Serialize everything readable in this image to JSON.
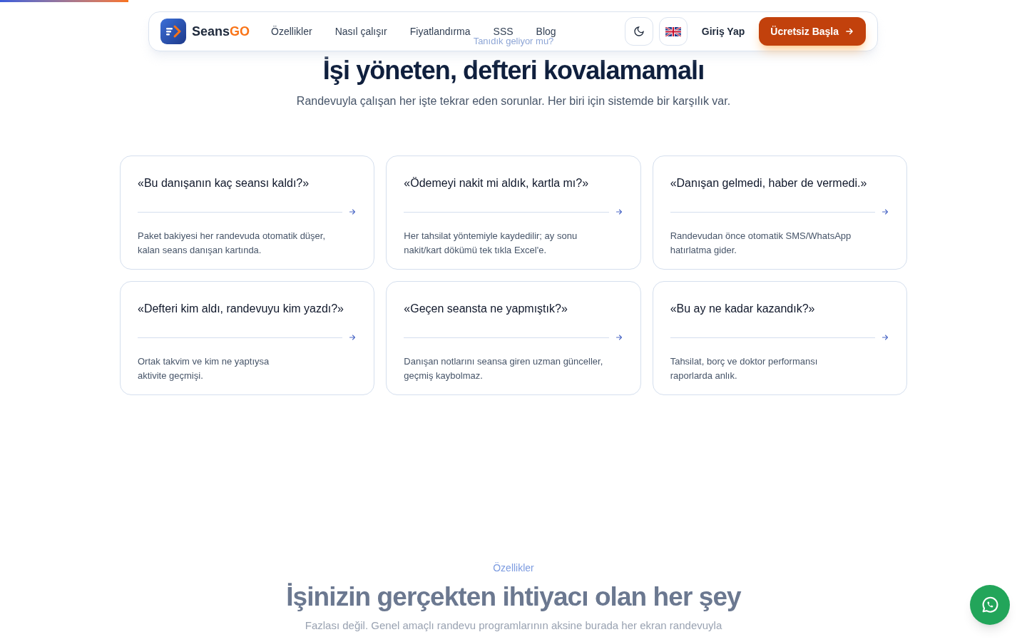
{
  "scroll_progress": {
    "level": 0.125
  },
  "nav": {
    "brand": {
      "first": "Seans",
      "second": "GO"
    },
    "links": [
      "Özellikler",
      "Nasıl çalışır",
      "Fiyatlandırma",
      "SSS",
      "Blog"
    ],
    "login": "Giriş Yap",
    "cta": "Ücretsiz Başla"
  },
  "problems": {
    "eyebrow": "Tanıdık geliyor mu?",
    "title": "İşi yöneten, defteri kovalamamalı",
    "subtitle": "Randevuyla çalışan her işte tekrar eden sorunlar. Her biri için sistemde bir karşılık var.",
    "cards": [
      {
        "question": "«Bu danışanın kaç seansı kaldı?»",
        "answer": "Paket bakiyesi her randevuda otomatik düşer,\nkalan seans danışan kartında."
      },
      {
        "question": "«Ödemeyi nakit mi aldık, kartla mı?»",
        "answer": "Her tahsilat yöntemiyle kaydedilir; ay sonu\nnakit/kart dökümü tek tıkla Excel'e."
      },
      {
        "question": "«Danışan gelmedi, haber de vermedi.»",
        "answer": "Randevudan önce otomatik SMS/WhatsApp\nhatırlatma gider."
      },
      {
        "question": "«Defteri kim aldı, randevuyu kim yazdı?»",
        "answer": "Ortak takvim ve kim ne yaptıysa\naktivite geçmişi."
      },
      {
        "question": "«Geçen seansta ne yapmıştık?»",
        "answer": "Danışan notlarını seansa giren uzman günceller,\ngeçmiş kaybolmaz."
      },
      {
        "question": "«Bu ay ne kadar kazandık?»",
        "answer": "Tahsilat, borç ve doktor performansı\nraporlarda anlık."
      }
    ]
  },
  "features": {
    "eyebrow": "Özellikler",
    "title": "İşinizin gerçekten ihtiyacı olan her şey",
    "subtitle": "Fazlası değil. Genel amaçlı randevu programlarının aksine burada her ekran randevuyla"
  }
}
